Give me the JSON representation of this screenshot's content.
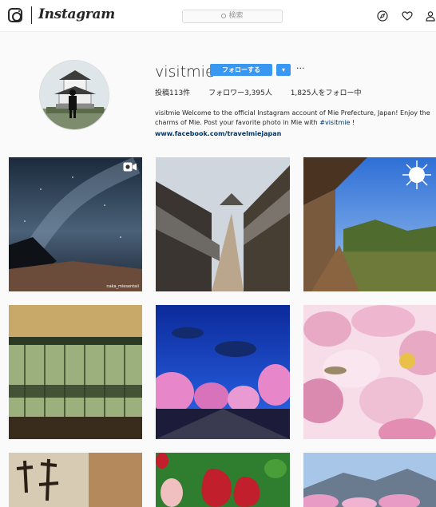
{
  "header": {
    "wordmark": "Instagram",
    "search_placeholder": "検索",
    "icons": [
      "instagram-logo-icon",
      "compass-icon",
      "heart-icon",
      "person-icon"
    ]
  },
  "profile": {
    "username": "visitmie",
    "follow_label": "フォローする",
    "dropdown_label": "▾",
    "more_label": "···",
    "stats": {
      "posts": "投稿113件",
      "followers": "フォロワー3,395人",
      "following": "1,825人をフォロー中"
    },
    "bio_text": "visitmie Welcome to the official Instagram account of Mie Prefecture, Japan! Enjoy the charms of Mie. Post your favorite photo in Mie with",
    "bio_hashtag": "#visitmie",
    "bio_end": "!",
    "bio_link": "www.facebook.com/travelmiejapan"
  },
  "grid": {
    "video_badge": "video-camera-icon",
    "credit_text": "naka_miesentaii",
    "tiles": [
      {
        "subject": "milky-way-over-coast",
        "colors": [
          "#1b2a3c",
          "#4a6178",
          "#8b6a55"
        ]
      },
      {
        "subject": "old-town-street",
        "colors": [
          "#6d6a66",
          "#b9a68c",
          "#3a3530"
        ]
      },
      {
        "subject": "veranda-and-sun",
        "colors": [
          "#2e6fd6",
          "#7a5a3c",
          "#4f6b2e"
        ]
      },
      {
        "subject": "forest-through-window",
        "colors": [
          "#c9a96a",
          "#9cb07e",
          "#2c3a23"
        ]
      },
      {
        "subject": "night-blossoms-blue-sky",
        "colors": [
          "#1f4bd2",
          "#e786c9",
          "#1c1c3a"
        ]
      },
      {
        "subject": "plum-blossom-garden",
        "colors": [
          "#e7a9c4",
          "#f6dde8",
          "#9a8a6a"
        ]
      },
      {
        "subject": "calligraphy-paper",
        "colors": [
          "#d8cbb4",
          "#b48a5c",
          "#2a1f14"
        ]
      },
      {
        "subject": "strawberries",
        "colors": [
          "#c01f2b",
          "#2f7d2e",
          "#f0c0c0"
        ]
      },
      {
        "subject": "mountain-and-flowers",
        "colors": [
          "#a8c7e8",
          "#6a7b8f",
          "#e89cc5"
        ]
      }
    ]
  }
}
